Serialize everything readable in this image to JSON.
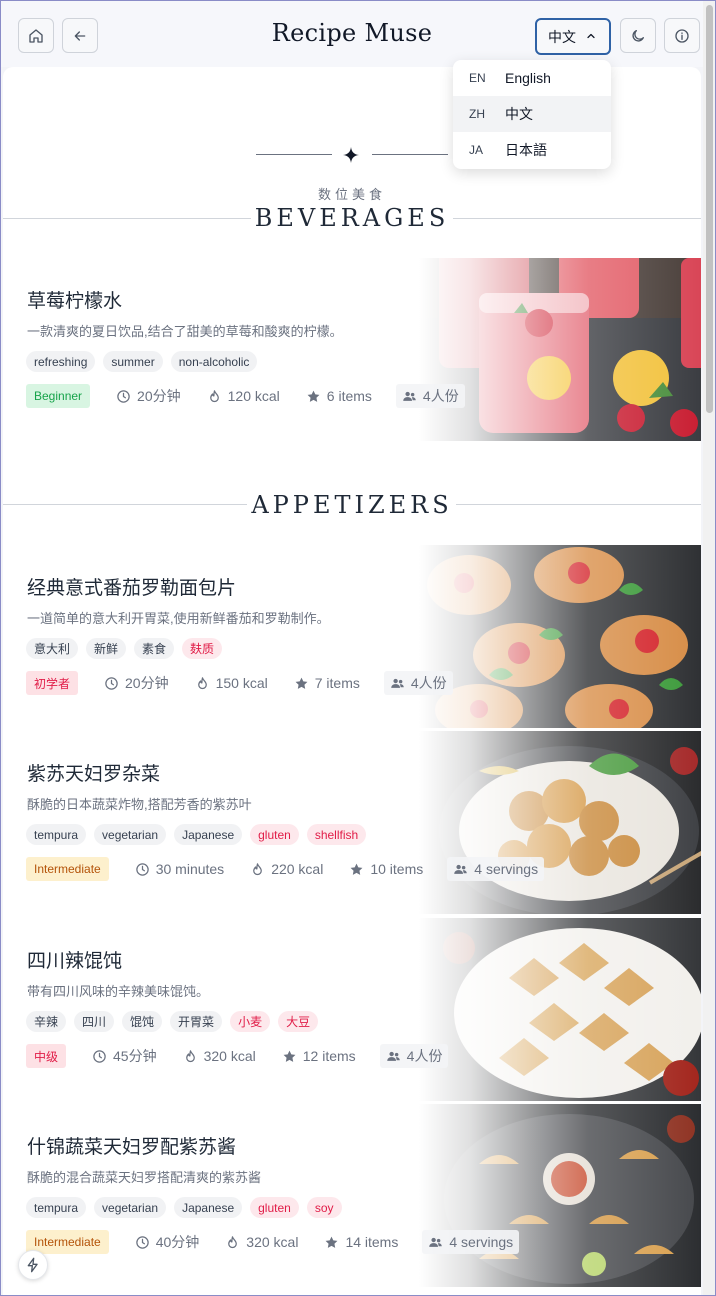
{
  "app": {
    "title": "Recipe Muse"
  },
  "header": {
    "home_icon": "home-icon",
    "back_icon": "arrow-left-icon",
    "language_current": "中文",
    "theme_icon": "moon-icon",
    "info_icon": "info-icon"
  },
  "language_menu": [
    {
      "code": "EN",
      "label": "English"
    },
    {
      "code": "ZH",
      "label": "中文",
      "selected": true
    },
    {
      "code": "JA",
      "label": "日本語"
    }
  ],
  "hero": {
    "subtitle": "数位美食"
  },
  "sections": [
    {
      "title": "BEVERAGES",
      "recipes": [
        {
          "name": "草莓柠檬水",
          "description": "一款清爽的夏日饮品,结合了甜美的草莓和酸爽的柠檬。",
          "tags": [
            {
              "label": "refreshing",
              "allergen": false
            },
            {
              "label": "summer",
              "allergen": false
            },
            {
              "label": "non-alcoholic",
              "allergen": false
            }
          ],
          "level": "Beginner",
          "level_color": "#16a34a",
          "time": "20分钟",
          "calories": "120 kcal",
          "ingredients": "6 items",
          "servings": "4人份",
          "image": "strawberry-lemonade-photo"
        }
      ]
    },
    {
      "title": "APPETIZERS",
      "recipes": [
        {
          "name": "经典意式番茄罗勒面包片",
          "description": "一道简单的意大利开胃菜,使用新鲜番茄和罗勒制作。",
          "tags": [
            {
              "label": "意大利",
              "allergen": false
            },
            {
              "label": "新鲜",
              "allergen": false
            },
            {
              "label": "素食",
              "allergen": false
            },
            {
              "label": "麸质",
              "allergen": true
            }
          ],
          "level": "初学者",
          "level_color": "#e11d48",
          "time": "20分钟",
          "calories": "150 kcal",
          "ingredients": "7 items",
          "servings": "4人份",
          "image": "bruschetta-photo"
        },
        {
          "name": "紫苏天妇罗杂菜",
          "description": "酥脆的日本蔬菜炸物,搭配芳香的紫苏叶",
          "tags": [
            {
              "label": "tempura",
              "allergen": false
            },
            {
              "label": "vegetarian",
              "allergen": false
            },
            {
              "label": "Japanese",
              "allergen": false
            },
            {
              "label": "gluten",
              "allergen": true
            },
            {
              "label": "shellfish",
              "allergen": true
            }
          ],
          "level": "Intermediate",
          "level_color": "#b45309",
          "time": "30 minutes",
          "calories": "220 kcal",
          "ingredients": "10 items",
          "servings": "4 servings",
          "image": "tempura-kakiage-photo"
        },
        {
          "name": "四川辣馄饨",
          "description": "带有四川风味的辛辣美味馄饨。",
          "tags": [
            {
              "label": "辛辣",
              "allergen": false
            },
            {
              "label": "四川",
              "allergen": false
            },
            {
              "label": "馄饨",
              "allergen": false
            },
            {
              "label": "开胃菜",
              "allergen": false
            },
            {
              "label": "小麦",
              "allergen": true
            },
            {
              "label": "大豆",
              "allergen": true
            }
          ],
          "level": "中级",
          "level_color": "#e11d48",
          "time": "45分钟",
          "calories": "320 kcal",
          "ingredients": "12 items",
          "servings": "4人份",
          "image": "wontons-photo"
        },
        {
          "name": "什锦蔬菜天妇罗配紫苏酱",
          "description": "酥脆的混合蔬菜天妇罗搭配清爽的紫苏酱",
          "tags": [
            {
              "label": "tempura",
              "allergen": false
            },
            {
              "label": "vegetarian",
              "allergen": false
            },
            {
              "label": "Japanese",
              "allergen": false
            },
            {
              "label": "gluten",
              "allergen": true
            },
            {
              "label": "soy",
              "allergen": true
            }
          ],
          "level": "Intermediate",
          "level_color": "#b45309",
          "time": "40分钟",
          "calories": "320 kcal",
          "ingredients": "14 items",
          "servings": "4 servings",
          "image": "gyoza-tempura-photo"
        }
      ]
    }
  ]
}
